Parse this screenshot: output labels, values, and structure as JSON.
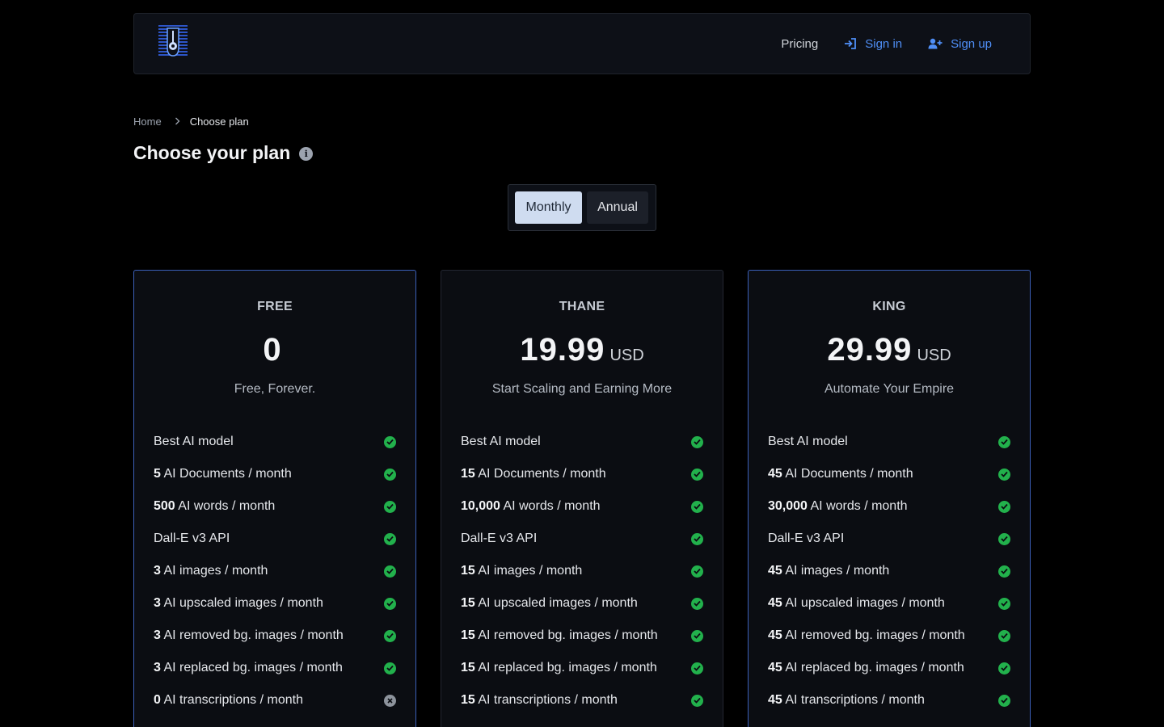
{
  "nav": {
    "pricing": "Pricing",
    "signin": "Sign in",
    "signup": "Sign up",
    "link_color": "#4f8ff7"
  },
  "breadcrumb": {
    "home": "Home",
    "current": "Choose plan"
  },
  "page": {
    "title": "Choose your plan"
  },
  "billing_toggle": {
    "monthly": "Monthly",
    "annual": "Annual",
    "selected": "Monthly"
  },
  "plans": [
    {
      "name": "FREE",
      "price": "0",
      "currency": "",
      "tagline": "Free, Forever.",
      "features": [
        {
          "bold": "",
          "text": "Best AI model",
          "included": true
        },
        {
          "bold": "5",
          "text": " AI Documents / month",
          "included": true
        },
        {
          "bold": "500",
          "text": " AI words / month",
          "included": true
        },
        {
          "bold": "",
          "text": "Dall-E v3 API",
          "included": true
        },
        {
          "bold": "3",
          "text": " AI images / month",
          "included": true
        },
        {
          "bold": "3",
          "text": " AI upscaled images / month",
          "included": true
        },
        {
          "bold": "3",
          "text": " AI removed bg. images / month",
          "included": true
        },
        {
          "bold": "3",
          "text": " AI replaced bg. images / month",
          "included": true
        },
        {
          "bold": "0",
          "text": " AI transcriptions / month",
          "included": false
        }
      ]
    },
    {
      "name": "THANE",
      "price": "19.99",
      "currency": "USD",
      "tagline": "Start Scaling and Earning More",
      "features": [
        {
          "bold": "",
          "text": "Best AI model",
          "included": true
        },
        {
          "bold": "15",
          "text": " AI Documents / month",
          "included": true
        },
        {
          "bold": "10,000",
          "text": " AI words / month",
          "included": true
        },
        {
          "bold": "",
          "text": "Dall-E v3 API",
          "included": true
        },
        {
          "bold": "15",
          "text": " AI images / month",
          "included": true
        },
        {
          "bold": "15",
          "text": " AI upscaled images / month",
          "included": true
        },
        {
          "bold": "15",
          "text": " AI removed bg. images / month",
          "included": true
        },
        {
          "bold": "15",
          "text": " AI replaced bg. images / month",
          "included": true
        },
        {
          "bold": "15",
          "text": " AI transcriptions / month",
          "included": true
        }
      ]
    },
    {
      "name": "KING",
      "price": "29.99",
      "currency": "USD",
      "tagline": "Automate Your Empire",
      "features": [
        {
          "bold": "",
          "text": "Best AI model",
          "included": true
        },
        {
          "bold": "45",
          "text": " AI Documents / month",
          "included": true
        },
        {
          "bold": "30,000",
          "text": " AI words / month",
          "included": true
        },
        {
          "bold": "",
          "text": "Dall-E v3 API",
          "included": true
        },
        {
          "bold": "45",
          "text": " AI images / month",
          "included": true
        },
        {
          "bold": "45",
          "text": " AI upscaled images / month",
          "included": true
        },
        {
          "bold": "45",
          "text": " AI removed bg. images / month",
          "included": true
        },
        {
          "bold": "45",
          "text": " AI replaced bg. images / month",
          "included": true
        },
        {
          "bold": "45",
          "text": " AI transcriptions / month",
          "included": true
        }
      ]
    }
  ],
  "colors": {
    "background": "#000000",
    "card": "#0b0d12",
    "highlight_border": "#3b5fb8",
    "check": "#22b14c",
    "cross": "#8d939c"
  }
}
